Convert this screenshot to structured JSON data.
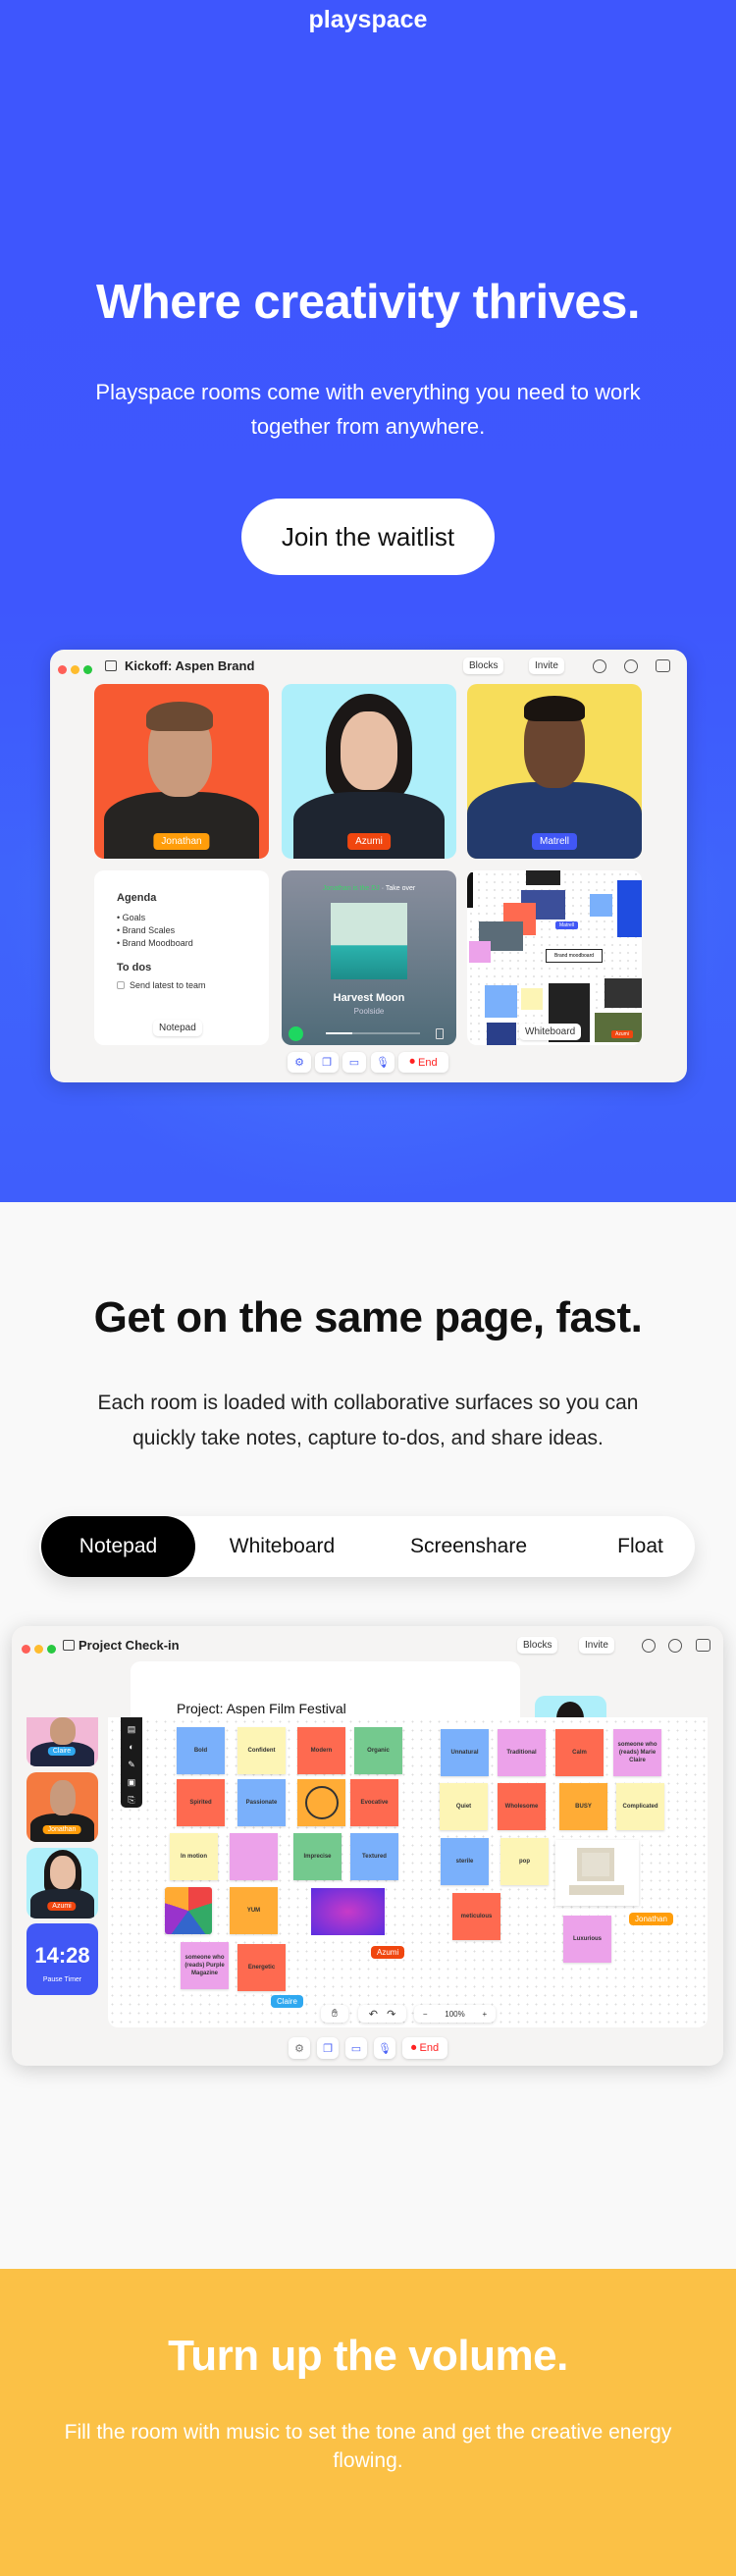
{
  "brand": "playspace",
  "hero": {
    "title": "Where creativity thrives.",
    "subtitle_lines": [
      "Playspace rooms come with everything you need to work",
      "together from anywhere."
    ],
    "cta": "Join the waitlist",
    "bg_color": "#3e57fd"
  },
  "room1": {
    "title": "Kickoff: Aspen Brand",
    "blocks": "Blocks",
    "invite": "Invite",
    "participants": [
      {
        "name": "Jonathan",
        "bg": "#f75a32",
        "badge": "#ff9d0a"
      },
      {
        "name": "Azumi",
        "bg": "#aeeffa",
        "badge": "#f0460f"
      },
      {
        "name": "Matrell",
        "bg": "#f7dd5a",
        "badge": "#4157f5"
      }
    ],
    "notepad": {
      "agenda": "Agenda",
      "items": [
        "Goals",
        "Brand Scales",
        "Brand Moodboard"
      ],
      "todos": "To dos",
      "todo_items": [
        "Send latest to team"
      ],
      "button": "Notepad"
    },
    "music": {
      "dj": "Jonathan is the DJ",
      "take_over": "· Take over",
      "track": "Harvest Moon",
      "artist": "Poolside",
      "progress": 0.28
    },
    "whiteboard": {
      "button": "Whiteboard",
      "label": "Brand moodboard",
      "cursors": [
        "Matrell",
        "Azumi"
      ]
    },
    "end": "End"
  },
  "section2": {
    "title": "Get on the same page, fast.",
    "body_lines": [
      "Each room is loaded with collaborative surfaces so you can",
      "quickly take notes, capture to-dos, and share ideas."
    ],
    "tabs": [
      {
        "label": "Notepad",
        "active": true
      },
      {
        "label": "Whiteboard",
        "active": false
      },
      {
        "label": "Screenshare",
        "active": false
      },
      {
        "label": "Float",
        "active": false
      }
    ]
  },
  "room2": {
    "title": "Project Check-in",
    "blocks": "Blocks",
    "invite": "Invite",
    "doc_title": "Project: Aspen Film Festival",
    "participants": [
      {
        "name": "Claire",
        "bg": "#f2b8d6",
        "badge": "#2fa8f0"
      },
      {
        "name": "Jonathan",
        "bg": "#f47a40",
        "badge": "#ff9d0a"
      },
      {
        "name": "Azumi",
        "bg": "#aeeffa",
        "badge": "#f0460f"
      }
    ],
    "timer": {
      "time": "14:28",
      "label": "Pause Timer"
    },
    "stickies": [
      {
        "text": "Bold",
        "color": "#7ab0fb"
      },
      {
        "text": "Confident",
        "color": "#fdf5b5"
      },
      {
        "text": "Modern",
        "color": "#fe6a50"
      },
      {
        "text": "Organic",
        "color": "#74c98e"
      },
      {
        "text": "Unnatural",
        "color": "#7ab0fb"
      },
      {
        "text": "Traditional",
        "color": "#eca2ea"
      },
      {
        "text": "Calm",
        "color": "#fe6a50"
      },
      {
        "text": "someone who (reads) Marie Claire",
        "color": "#eca2ea"
      },
      {
        "text": "Spirited",
        "color": "#fe6a50"
      },
      {
        "text": "Passionate",
        "color": "#7ab0fb"
      },
      {
        "text": "",
        "color": "#ffac36"
      },
      {
        "text": "Evocative",
        "color": "#fe6a50"
      },
      {
        "text": "Quiet",
        "color": "#fdf5b5"
      },
      {
        "text": "Wholesome",
        "color": "#fe6a50"
      },
      {
        "text": "BUSY",
        "color": "#ffac36"
      },
      {
        "text": "Complicated",
        "color": "#fdf5b5"
      },
      {
        "text": "In motion",
        "color": "#fdf5b5"
      },
      {
        "text": "",
        "color": "#eca2ea"
      },
      {
        "text": "Imprecise",
        "color": "#74c98e"
      },
      {
        "text": "Textured",
        "color": "#7ab0fb"
      },
      {
        "text": "sterile",
        "color": "#7ab0fb"
      },
      {
        "text": "pop",
        "color": "#fdf5b5"
      },
      {
        "text": "YUM",
        "color": "#ffac36"
      },
      {
        "text": "meticulous",
        "color": "#fe6a50"
      },
      {
        "text": "someone who (reads) Purple Magazine",
        "color": "#eca2ea"
      },
      {
        "text": "Energetic",
        "color": "#fe6a50"
      },
      {
        "text": "Luxurious",
        "color": "#eca2ea"
      }
    ],
    "cursors": [
      {
        "name": "Azumi",
        "color": "#f0460f"
      },
      {
        "name": "Claire",
        "color": "#2fa8f0"
      },
      {
        "name": "Jonathan",
        "color": "#ff9d0a"
      }
    ],
    "zoom": "100%",
    "end": "End"
  },
  "section3": {
    "title": "Turn up the volume.",
    "body_lines": [
      "Fill the room with music to set the tone and get the creative energy",
      "flowing."
    ],
    "bg_color": "#fbc146"
  }
}
